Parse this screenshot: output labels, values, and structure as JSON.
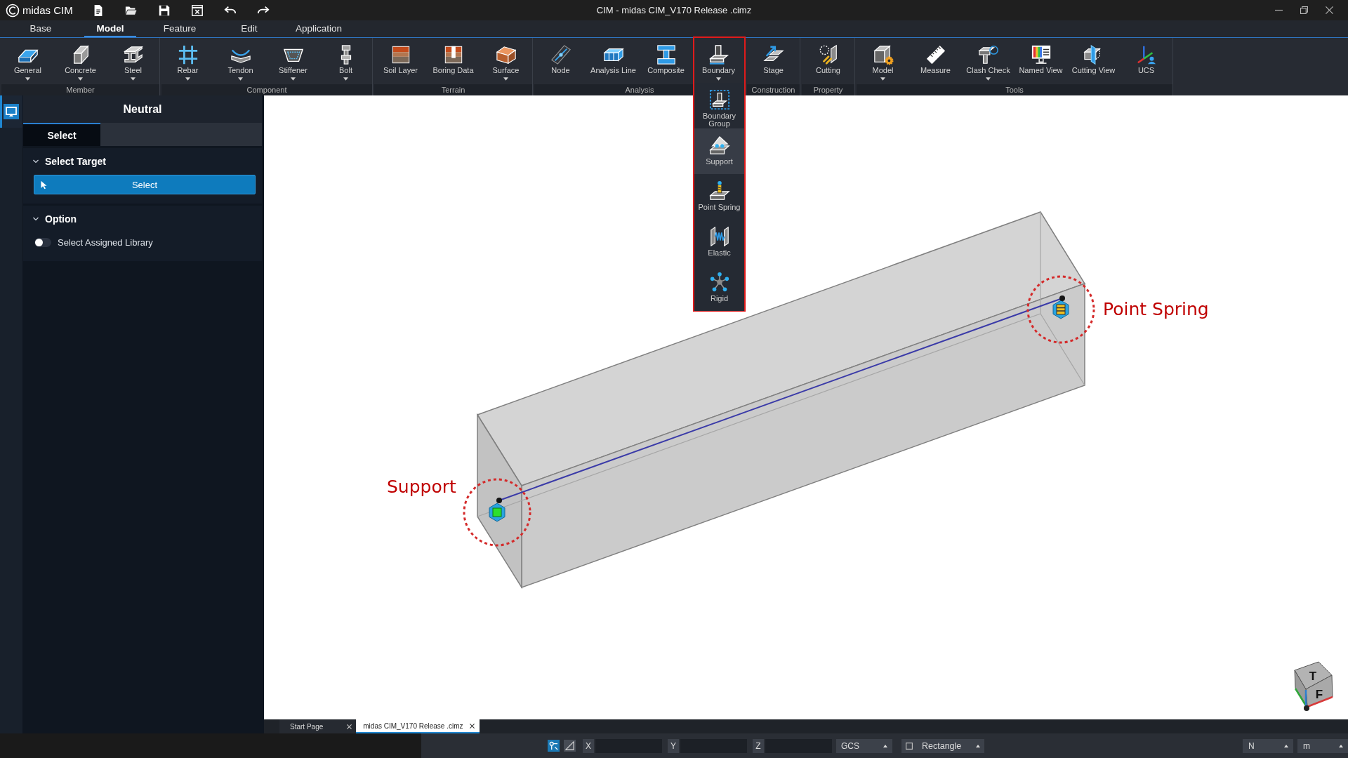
{
  "title_bar": {
    "app_name": "midas CIM",
    "title": "CIM - midas CIM_V170 Release .cimz"
  },
  "menu_tabs": [
    {
      "label": "Base",
      "selected": false
    },
    {
      "label": "Model",
      "selected": true
    },
    {
      "label": "Feature",
      "selected": false
    },
    {
      "label": "Edit",
      "selected": false
    },
    {
      "label": "Application",
      "selected": false
    }
  ],
  "ribbon": {
    "groups": [
      {
        "label": "Member",
        "buttons": [
          {
            "label": "General",
            "dropdown": true
          },
          {
            "label": "Concrete",
            "dropdown": true
          },
          {
            "label": "Steel",
            "dropdown": true
          }
        ]
      },
      {
        "label": "Component",
        "buttons": [
          {
            "label": "Rebar",
            "dropdown": true
          },
          {
            "label": "Tendon",
            "dropdown": true
          },
          {
            "label": "Stiffener",
            "dropdown": true
          },
          {
            "label": "Bolt",
            "dropdown": true
          }
        ]
      },
      {
        "label": "Terrain",
        "buttons": [
          {
            "label": "Soil Layer",
            "dropdown": false
          },
          {
            "label": "Boring Data",
            "dropdown": false
          },
          {
            "label": "Surface",
            "dropdown": true
          }
        ]
      },
      {
        "label": "Analysis",
        "buttons": [
          {
            "label": "Node",
            "dropdown": false
          },
          {
            "label": "Analysis Line",
            "dropdown": false
          },
          {
            "label": "Composite",
            "dropdown": false
          },
          {
            "label": "Boundary",
            "dropdown": true
          }
        ]
      },
      {
        "label": "Construction",
        "buttons": [
          {
            "label": "Stage",
            "dropdown": false
          }
        ]
      },
      {
        "label": "Property",
        "buttons": [
          {
            "label": "Cutting",
            "dropdown": false
          }
        ]
      },
      {
        "label": "Tools",
        "buttons": [
          {
            "label": "Model",
            "dropdown": true
          },
          {
            "label": "Measure",
            "dropdown": false
          },
          {
            "label": "Clash Check",
            "dropdown": true
          },
          {
            "label": "Named View",
            "dropdown": false
          },
          {
            "label": "Cutting View",
            "dropdown": false
          },
          {
            "label": "UCS",
            "dropdown": false
          }
        ]
      }
    ]
  },
  "dropdown_menu": {
    "outlined": true,
    "items": [
      {
        "label": "Boundary Group",
        "selected": false
      },
      {
        "label": "Support",
        "selected": true
      },
      {
        "label": "Point Spring",
        "selected": false
      },
      {
        "label": "Elastic",
        "selected": false
      },
      {
        "label": "Rigid",
        "selected": false
      }
    ]
  },
  "activity_bar": {
    "items": [
      {
        "selected": true
      }
    ]
  },
  "side_panel": {
    "title": "Neutral",
    "tabs": [
      {
        "label": "Select",
        "selected": true
      }
    ],
    "sections": [
      {
        "title": "Select Target",
        "expanded": true,
        "items": [
          {
            "kind": "button",
            "label": "Select"
          }
        ]
      },
      {
        "title": "Option",
        "expanded": true,
        "items": [
          {
            "kind": "toggle",
            "label": "Select Assigned Library",
            "on": false
          }
        ]
      }
    ]
  },
  "viewport": {
    "callouts": [
      {
        "label": "Support"
      },
      {
        "label": "Point Spring"
      }
    ],
    "view_cube": {
      "faces": [
        "T",
        "F"
      ]
    }
  },
  "document_tabs": [
    {
      "label": "Start Page",
      "selected": false
    },
    {
      "label": "midas CIM_V170 Release .cimz",
      "selected": true
    }
  ],
  "status_bar": {
    "toggles": [
      {
        "on": true
      },
      {
        "on": false
      }
    ],
    "coordinates": [
      {
        "label": "X"
      },
      {
        "label": "Y"
      },
      {
        "label": "Z"
      }
    ],
    "coordinate_system": "GCS",
    "selection_mode": "Rectangle",
    "units": [
      "N",
      "m"
    ]
  }
}
